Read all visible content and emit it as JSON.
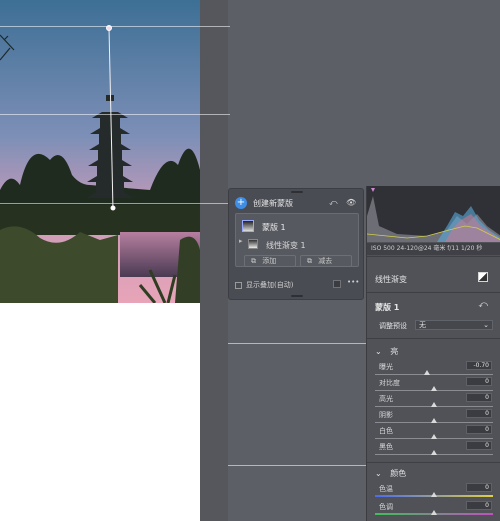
{
  "mask_panel": {
    "create_label": "创建新蒙版",
    "mask_name": "蒙版 1",
    "sub_mask_name": "线性渐变 1",
    "add_button": "添加",
    "subtract_button": "减去",
    "overlay_label": "显示叠加(自动)",
    "more_label": "•••"
  },
  "dev_panel": {
    "camera_info": "ISO 500   24-120@24 毫米   f/11   1/20 秒",
    "tool_title": "线性渐变",
    "mask_label": "蒙版 1",
    "preset_label": "调整预设",
    "preset_value": "无",
    "light_section": "亮",
    "color_section": "颜色",
    "sliders": [
      {
        "label": "曝光",
        "value": "-0.70"
      },
      {
        "label": "对比度",
        "value": "0"
      },
      {
        "label": "高光",
        "value": "0"
      },
      {
        "label": "阴影",
        "value": "0"
      },
      {
        "label": "白色",
        "value": "0"
      },
      {
        "label": "黑色",
        "value": "0"
      }
    ],
    "color_sliders": [
      {
        "label": "色温",
        "value": "0"
      },
      {
        "label": "色调",
        "value": "0"
      }
    ]
  },
  "colors": {
    "accent": "#3e8ee6",
    "panel": "#505258",
    "workspace": "#5d5f66"
  }
}
